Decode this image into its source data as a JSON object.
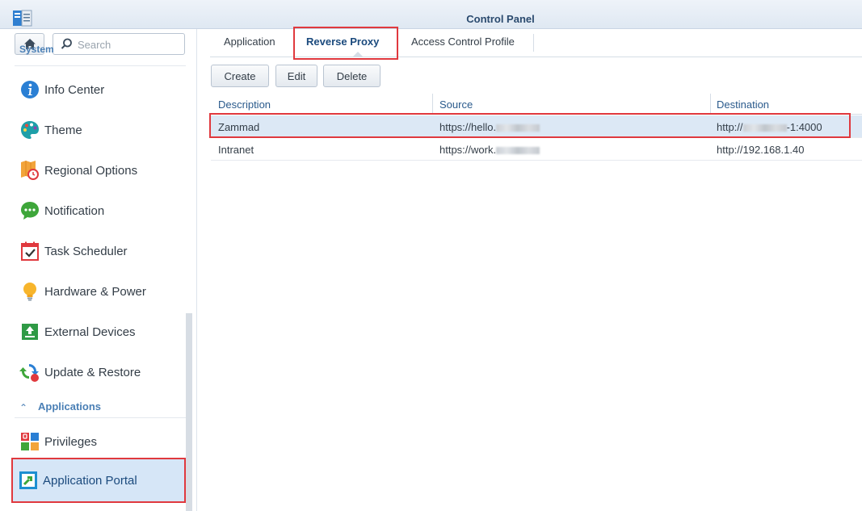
{
  "window": {
    "title": "Control Panel"
  },
  "sidebar": {
    "search_placeholder": "Search",
    "section_prev": "System",
    "items": [
      {
        "label": "Info Center",
        "icon": "info-icon"
      },
      {
        "label": "Theme",
        "icon": "palette-icon"
      },
      {
        "label": "Regional Options",
        "icon": "map-clock-icon"
      },
      {
        "label": "Notification",
        "icon": "chat-bubble-icon"
      },
      {
        "label": "Task Scheduler",
        "icon": "calendar-check-icon"
      },
      {
        "label": "Hardware & Power",
        "icon": "lightbulb-icon"
      },
      {
        "label": "External Devices",
        "icon": "upload-drive-icon"
      },
      {
        "label": "Update & Restore",
        "icon": "refresh-icon"
      }
    ],
    "section_applications": "Applications",
    "app_items": [
      {
        "label": "Privileges",
        "icon": "privileges-icon"
      },
      {
        "label": "Application Portal",
        "icon": "portal-icon",
        "active": true
      }
    ]
  },
  "main": {
    "tabs": [
      {
        "label": "Application"
      },
      {
        "label": "Reverse Proxy",
        "active": true
      },
      {
        "label": "Access Control Profile"
      }
    ],
    "toolbar": {
      "create": "Create",
      "edit": "Edit",
      "delete": "Delete"
    },
    "table": {
      "columns": [
        "Description",
        "Source",
        "Destination"
      ],
      "rows": [
        {
          "description": "Zammad",
          "source_prefix": "https://hello.",
          "dest_prefix": "http://",
          "dest_suffix": "-1:4000",
          "selected": true
        },
        {
          "description": "Intranet",
          "source_prefix": "https://work.",
          "dest": "http://192.168.1.40"
        }
      ]
    }
  },
  "colors": {
    "accent": "#2a5a8c",
    "highlight": "#e0393e",
    "selection": "#dce8f5"
  }
}
